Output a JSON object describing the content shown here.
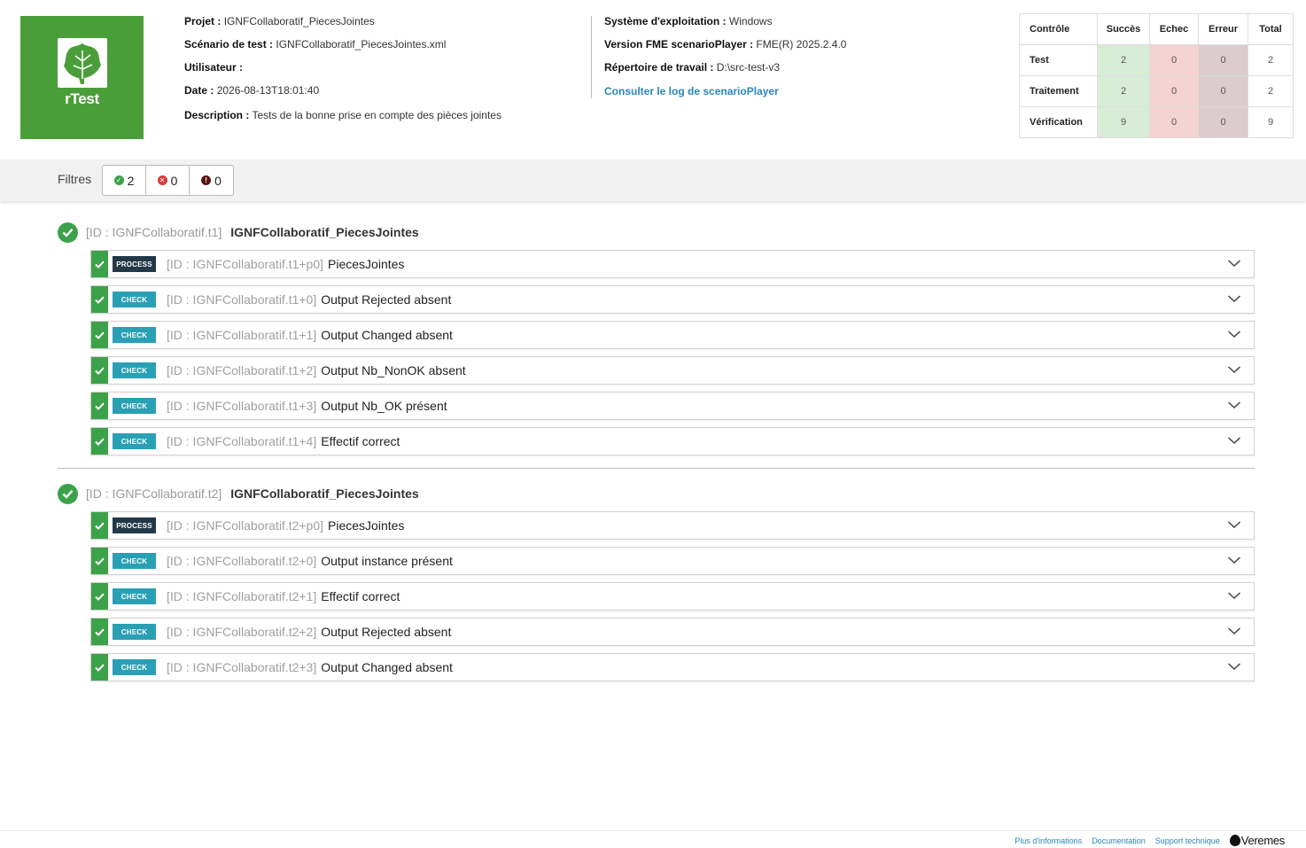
{
  "app": {
    "logo_text": "rTest"
  },
  "info_left": [
    {
      "label": "Projet :",
      "value": "IGNFCollaboratif_PiecesJointes"
    },
    {
      "label": "Scénario de test :",
      "value": "IGNFCollaboratif_PiecesJointes.xml"
    },
    {
      "label": "Utilisateur :",
      "value": ""
    },
    {
      "label": "Date :",
      "value": "2026-08-13T18:01:40"
    },
    {
      "label": "Description :",
      "value": "Tests de la bonne prise en compte des pièces jointes"
    }
  ],
  "info_right": [
    {
      "label": "Système d'exploitation :",
      "value": "Windows"
    },
    {
      "label": "Version FME scenarioPlayer :",
      "value": "FME(R) 2025.2.4.0"
    },
    {
      "label": "Répertoire de travail :",
      "value": "D:\\src-test-v3"
    }
  ],
  "log_link": "Consulter le log de scenarioPlayer",
  "summary": {
    "headers": [
      "Contrôle",
      "Succès",
      "Echec",
      "Erreur",
      "Total"
    ],
    "rows": [
      {
        "label": "Test",
        "success": "2",
        "fail": "0",
        "error": "0",
        "total": "2"
      },
      {
        "label": "Traitement",
        "success": "2",
        "fail": "0",
        "error": "0",
        "total": "2"
      },
      {
        "label": "Vérification",
        "success": "9",
        "fail": "0",
        "error": "0",
        "total": "9"
      }
    ]
  },
  "filters": {
    "label": "Filtres",
    "success_count": "2",
    "fail_count": "0",
    "error_count": "0",
    "colors": {
      "success": "#3ca24a",
      "fail": "#d9383a",
      "error": "#5b1212"
    }
  },
  "groups": [
    {
      "id": "[ID : IGNFCollaboratif.t1]",
      "title": "IGNFCollaboratif_PiecesJointes",
      "steps": [
        {
          "badge": "PROCESS",
          "id": "[ID : IGNFCollaboratif.t1+p0]",
          "title": "PiecesJointes"
        },
        {
          "badge": "CHECK",
          "id": "[ID : IGNFCollaboratif.t1+0]",
          "title": "Output Rejected absent"
        },
        {
          "badge": "CHECK",
          "id": "[ID : IGNFCollaboratif.t1+1]",
          "title": "Output Changed absent"
        },
        {
          "badge": "CHECK",
          "id": "[ID : IGNFCollaboratif.t1+2]",
          "title": "Output Nb_NonOK absent"
        },
        {
          "badge": "CHECK",
          "id": "[ID : IGNFCollaboratif.t1+3]",
          "title": "Output Nb_OK présent"
        },
        {
          "badge": "CHECK",
          "id": "[ID : IGNFCollaboratif.t1+4]",
          "title": "Effectif correct"
        }
      ]
    },
    {
      "id": "[ID : IGNFCollaboratif.t2]",
      "title": "IGNFCollaboratif_PiecesJointes",
      "steps": [
        {
          "badge": "PROCESS",
          "id": "[ID : IGNFCollaboratif.t2+p0]",
          "title": "PiecesJointes"
        },
        {
          "badge": "CHECK",
          "id": "[ID : IGNFCollaboratif.t2+0]",
          "title": "Output instance présent"
        },
        {
          "badge": "CHECK",
          "id": "[ID : IGNFCollaboratif.t2+1]",
          "title": "Effectif correct"
        },
        {
          "badge": "CHECK",
          "id": "[ID : IGNFCollaboratif.t2+2]",
          "title": "Output Rejected absent"
        },
        {
          "badge": "CHECK",
          "id": "[ID : IGNFCollaboratif.t2+3]",
          "title": "Output Changed absent"
        }
      ]
    }
  ],
  "footer": {
    "links": [
      "Plus d'informations",
      "Documentation",
      "Support technique"
    ],
    "brand": "Veremes"
  }
}
